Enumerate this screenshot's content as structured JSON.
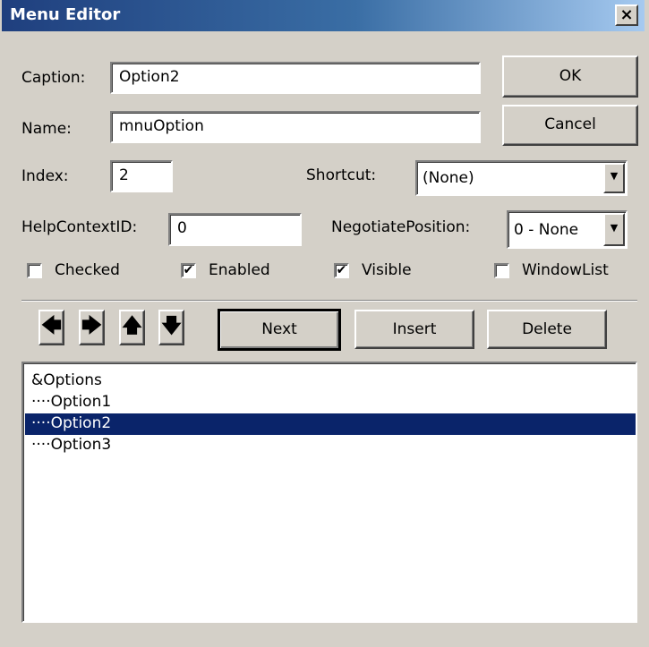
{
  "window": {
    "title": "Menu Editor",
    "close_glyph": "×"
  },
  "fields": {
    "caption": {
      "label": "Caption:",
      "value": "Option2"
    },
    "name": {
      "label": "Name:",
      "value": "mnuOption"
    },
    "index": {
      "label": "Index:",
      "value": "2"
    },
    "shortcut": {
      "label": "Shortcut:",
      "value": "(None)"
    },
    "help_context": {
      "label": "HelpContextID:",
      "value": "0"
    },
    "negotiate": {
      "label": "NegotiatePosition:",
      "value": "0 - None"
    }
  },
  "buttons": {
    "ok": "OK",
    "cancel": "Cancel",
    "next": "Next",
    "insert": "Insert",
    "delete": "Delete"
  },
  "checkboxes": [
    {
      "label": "Checked",
      "checked": false
    },
    {
      "label": "Enabled",
      "checked": true
    },
    {
      "label": "Visible",
      "checked": true
    },
    {
      "label": "WindowList",
      "checked": false
    }
  ],
  "arrows": {
    "left": "🡄",
    "right": "🡆",
    "up": "🡅",
    "down": "🡇"
  },
  "menu_items": [
    {
      "text": "&Options",
      "selected": false
    },
    {
      "text": "····Option1",
      "selected": false
    },
    {
      "text": "····Option2",
      "selected": true
    },
    {
      "text": "····Option3",
      "selected": false
    }
  ],
  "colors": {
    "face": "#d4d0c8",
    "title_start": "#1f3f7e",
    "selection": "#0a246a"
  },
  "check_mark": "✔"
}
